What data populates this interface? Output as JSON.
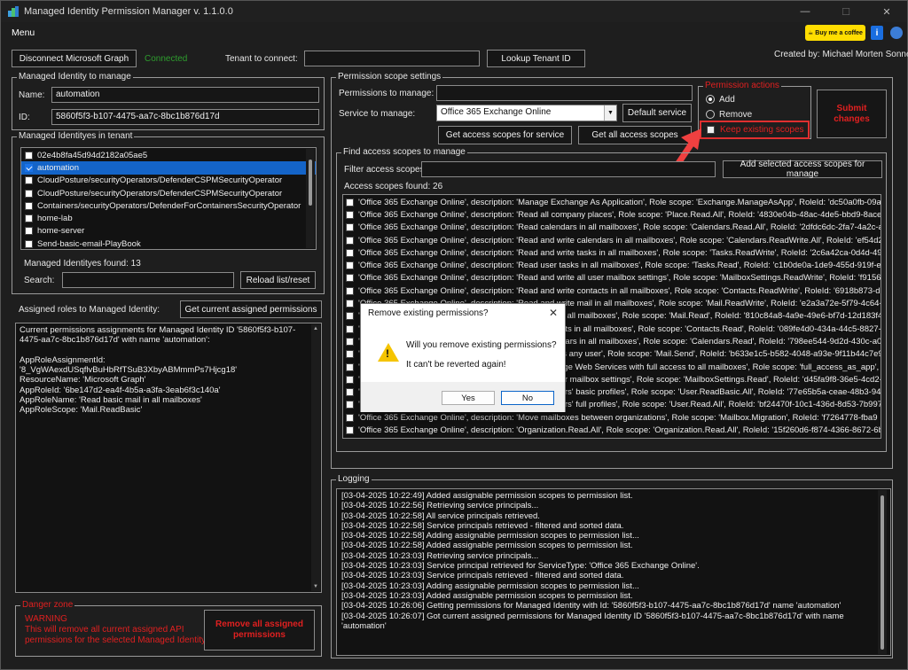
{
  "window": {
    "title": "Managed Identity Permission Manager v. 1.1.0.0",
    "min": "—",
    "max": "☐",
    "close": "✕"
  },
  "menu": {
    "label": "Menu"
  },
  "header_icons": {
    "coffee_label": "Buy me a coffee",
    "info_glyph": "i"
  },
  "top": {
    "disconnect_label": "Disconnect Microsoft Graph",
    "status": "Connected",
    "status_color": "#2e9e2e",
    "tenant_label": "Tenant to connect:",
    "tenant_value": "",
    "lookup_label": "Lookup Tenant ID",
    "created_by": "Created by: Michael Morten Sonne"
  },
  "identity": {
    "group_title": "Managed Identity to manage",
    "name_label": "Name:",
    "name_value": "automation",
    "id_label": "ID:",
    "id_value": "5860f5f3-b107-4475-aa7c-8bc1b876d17d"
  },
  "tenant_list": {
    "group_title": "Managed Identityes in tenant",
    "items": [
      {
        "label": "02e4b8fa45d94d2182a05ae5",
        "checked": false,
        "selected": false
      },
      {
        "label": "automation",
        "checked": true,
        "selected": true
      },
      {
        "label": "CloudPosture/securityOperators/DefenderCSPMSecurityOperator",
        "checked": false,
        "selected": false
      },
      {
        "label": "CloudPosture/securityOperators/DefenderCSPMSecurityOperator",
        "checked": false,
        "selected": false
      },
      {
        "label": "Containers/securityOperators/DefenderForContainersSecurityOperator",
        "checked": false,
        "selected": false
      },
      {
        "label": "home-lab",
        "checked": false,
        "selected": false
      },
      {
        "label": "home-server",
        "checked": false,
        "selected": false
      },
      {
        "label": "Send-basic-email-PlayBook",
        "checked": false,
        "selected": false
      }
    ],
    "found_label": "Managed Identityes found: 13",
    "search_label": "Search:",
    "search_value": "",
    "reload_label": "Reload list/reset"
  },
  "assigned": {
    "label": "Assigned roles to Managed Identity:",
    "get_button": "Get current assigned permissions",
    "lines": [
      "Current permissions assignments for Managed Identity ID '5860f5f3-b107-",
      "4475-aa7c-8bc1b876d17d' with name 'automation':",
      "",
      "AppRoleAssignmentId:",
      "'8_VgWAexdUSqflvBuHbRfTSuB3XbyABMmmPs7Hjcg18'",
      "ResourceName: 'Microsoft Graph'",
      "AppRoleId: '6be147d2-ea4f-4b5a-a3fa-3eab6f3c140a'",
      "AppRoleName: 'Read basic mail in all mailboxes'",
      "AppRoleScope: 'Mail.ReadBasic'"
    ]
  },
  "danger": {
    "group_title": "Danger zone",
    "warning_title": "WARNING",
    "warning_line1": "This will remove all current assigned API",
    "warning_line2": "permissions for the selected Managed Identity",
    "remove_line1": "Remove all assigned",
    "remove_line2": "permissions"
  },
  "scope": {
    "group_title": "Permission scope settings",
    "perm_label": "Permissions to manage:",
    "perm_value": "",
    "service_label": "Service to manage:",
    "service_value": "Office 365 Exchange Online",
    "default_service": "Default service",
    "get_for_service": "Get access scopes for service",
    "get_all": "Get all access scopes"
  },
  "actions": {
    "group_title": "Permission actions",
    "add_label": "Add",
    "remove_label": "Remove",
    "keep_label": "Keep existing scopes",
    "submit_line1": "Submit",
    "submit_line2": "changes"
  },
  "find": {
    "group_title": "Find access scopes to manage",
    "filter_label": "Filter access scopes:",
    "filter_value": "",
    "add_selected": "Add selected access scopes for manage",
    "found_label": "Access scopes found: 26",
    "items": [
      "'Office 365 Exchange Online', description: 'Manage Exchange As Application', Role scope: 'Exchange.ManageAsApp', RoleId: 'dc50a0fb-09a",
      "'Office 365 Exchange Online', description: 'Read all company places', Role scope: 'Place.Read.All', RoleId: '4830e04b-48ac-4de5-bbd9-8aceb",
      "'Office 365 Exchange Online', description: 'Read calendars in all mailboxes', Role scope: 'Calendars.Read.All', RoleId: '2dfdc6dc-2fa7-4a2c-a",
      "'Office 365 Exchange Online', description: 'Read and write calendars in all mailboxes', Role scope: 'Calendars.ReadWrite.All', RoleId: 'ef54d2",
      "'Office 365 Exchange Online', description: 'Read and write tasks in all mailboxes', Role scope: 'Tasks.ReadWrite', RoleId: '2c6a42ca-0d4d-49a",
      "'Office 365 Exchange Online', description: 'Read user tasks in all mailboxes', Role scope: 'Tasks.Read', RoleId: 'c1b0de0a-1de9-455d-919f-eca",
      "'Office 365 Exchange Online', description: 'Read and write all user mailbox settings', Role scope: 'MailboxSettings.ReadWrite', RoleId: 'f9156",
      "'Office 365 Exchange Online', description: 'Read and write contacts in all mailboxes', Role scope: 'Contacts.ReadWrite', RoleId: '6918b873-d1",
      "'Office 365 Exchange Online', description: 'Read and write mail in all mailboxes', Role scope: 'Mail.ReadWrite', RoleId: 'e2a3a72e-5f79-4c64-b",
      "'Office 365 Exchange Online', description: 'Read mail in all mailboxes', Role scope: 'Mail.Read', RoleId: '810c84a8-4a9e-49e6-bf7d-12d183f40",
      "'Office 365 Exchange Online', description: 'Read contacts in all mailboxes', Role scope: 'Contacts.Read', RoleId: '089fe4d0-434a-44c5-8827-4",
      "'Office 365 Exchange Online', description: 'Read calendars in all mailboxes', Role scope: 'Calendars.Read', RoleId: '798ee544-9d2d-430c-a058",
      "'Office 365 Exchange Online', description: 'Send mail as any user', Role scope: 'Mail.Send', RoleId: 'b633e1c5-b582-4048-a93e-9f11b44c7e96",
      "'Office 365 Exchange Online', description: 'Use Exchange Web Services with full access to all mailboxes', Role scope: 'full_access_as_app', RoleI",
      "'Office 365 Exchange Online', description: 'Read all user mailbox settings', Role scope: 'MailboxSettings.Read', RoleId: 'd45fa9f8-36e5-4cd2-",
      "'Office 365 Exchange Online', description: 'Read all users' basic profiles', Role scope: 'User.ReadBasic.All', RoleId: '77e65b5a-ceae-48b3-9490",
      "'Office 365 Exchange Online', description: 'Read all users' full profiles', Role scope: 'User.Read.All', RoleId: 'bf24470f-10c1-436d-8d53-7b997e",
      "'Office 365 Exchange Online', description: 'Move mailboxes between organizations', Role scope: 'Mailbox.Migration', RoleId: 'f7264778-fba9",
      "'Office 365 Exchange Online', description: 'Organization.Read.All', Role scope: 'Organization.Read.All', RoleId: '15f260d6-f874-4366-8672-6b"
    ]
  },
  "logging": {
    "group_title": "Logging",
    "lines": [
      "[03-04-2025 10:22:49] Added assignable permission scopes to permission list.",
      "[03-04-2025 10:22:56] Retrieving service principals...",
      "[03-04-2025 10:22:58] All service principals retrieved.",
      "[03-04-2025 10:22:58] Service principals retrieved - filtered and sorted data.",
      "[03-04-2025 10:22:58] Adding assignable permission scopes to permission list...",
      "[03-04-2025 10:22:58] Added assignable permission scopes to permission list.",
      "[03-04-2025 10:23:03] Retrieving service principals...",
      "[03-04-2025 10:23:03] Service principal retrieved for ServiceType: 'Office 365 Exchange Online'.",
      "[03-04-2025 10:23:03] Service principals retrieved - filtered and sorted data.",
      "[03-04-2025 10:23:03] Adding assignable permission scopes to permission list...",
      "[03-04-2025 10:23:03] Added assignable permission scopes to permission list.",
      "[03-04-2025 10:26:06] Getting permissions for Managed Identity with Id: '5860f5f3-b107-4475-aa7c-8bc1b876d17d' name 'automation'",
      "[03-04-2025 10:26:07] Got current assigned permissions for Managed Identity ID '5860f5f3-b107-4475-aa7c-8bc1b876d17d' with name",
      "'automation'"
    ]
  },
  "dialog": {
    "title": "Remove existing permissions?",
    "close": "✕",
    "line1": "Will you remove existing permissions?",
    "line2": "It can't be reverted again!",
    "yes": "Yes",
    "no": "No"
  },
  "colors": {
    "accent": "#1464c8",
    "danger": "#e02020",
    "highlight_box": "#e03030",
    "arrow": "#f04040"
  }
}
